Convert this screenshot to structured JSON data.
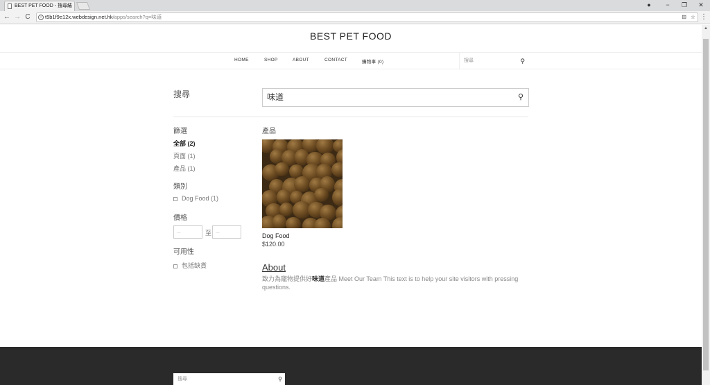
{
  "browser": {
    "tab_title": "BEST PET FOOD - 搜尋結",
    "tab_close": "×",
    "url_host": "t5b1f9e12x.webdesign.net.hk",
    "url_path": "/apps/search?q=味道",
    "back": "←",
    "forward": "→",
    "reload": "C",
    "info": "i",
    "translate": "⊞",
    "bookmark": "☆",
    "menu": "⋮",
    "account": "●",
    "minimize": "−",
    "restore": "❐",
    "close": "✕"
  },
  "site": {
    "title": "BEST PET FOOD",
    "nav": [
      "HOME",
      "SHOP",
      "ABOUT",
      "CONTACT",
      "購物車 (0)"
    ],
    "nav_search_placeholder": "搜尋",
    "search_glyph": "⚲"
  },
  "search": {
    "heading": "搜尋",
    "query": "味道"
  },
  "filters": {
    "heading": "篩選",
    "items": [
      {
        "label": "全部 (2)",
        "active": true
      },
      {
        "label": "頁面 (1)",
        "active": false
      },
      {
        "label": "產品 (1)",
        "active": false
      }
    ],
    "category_heading": "類別",
    "category_item": "Dog Food (1)",
    "price_heading": "價格",
    "price_min_placeholder": "...",
    "price_to": "至",
    "price_max_placeholder": "...",
    "availability_heading": "可用性",
    "availability_item": "包括缺貨"
  },
  "results": {
    "heading": "產品",
    "product_name": "Dog Food",
    "product_price": "$120.00",
    "page_title": "About",
    "page_text_pre": "致力為寵物提供好",
    "page_text_match": "味道",
    "page_text_post": "產品 Meet Our Team This text is to help your site visitors with pressing questions."
  },
  "footer": {
    "search_placeholder": "搜尋"
  }
}
